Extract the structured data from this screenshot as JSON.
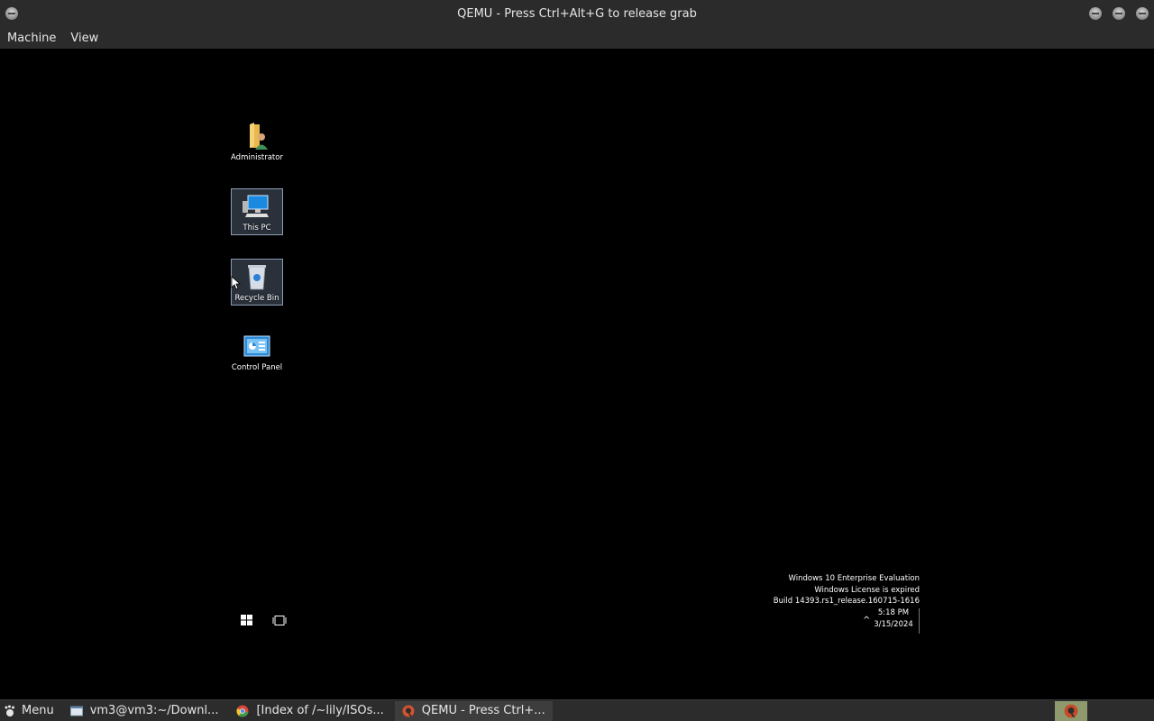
{
  "window": {
    "title": "QEMU - Press Ctrl+Alt+G to release grab",
    "menu": [
      "Machine",
      "View"
    ]
  },
  "desktop": {
    "icons": [
      {
        "label": "Administrator",
        "icon": "user-folder-icon",
        "selected": false
      },
      {
        "label": "This PC",
        "icon": "computer-icon",
        "selected": true
      },
      {
        "label": "Recycle Bin",
        "icon": "recycle-bin-icon",
        "selected": true
      },
      {
        "label": "Control Panel",
        "icon": "control-panel-icon",
        "selected": false
      }
    ],
    "watermark": [
      "Windows 10 Enterprise Evaluation",
      "Windows License is expired",
      "Build 14393.rs1_release.160715-1616"
    ],
    "tray": {
      "time": "5:18 PM",
      "date": "3/15/2024",
      "chevron": "^"
    }
  },
  "host_panel": {
    "menu_label": "Menu",
    "tasks": [
      {
        "label": "vm3@vm3:~/Downl...",
        "icon": "terminal-icon",
        "active": false
      },
      {
        "label": "[Index of /~lily/ISOs...",
        "icon": "chrome-icon",
        "active": false
      },
      {
        "label": "QEMU - Press Ctrl+...",
        "icon": "qemu-icon",
        "active": true
      }
    ]
  },
  "colors": {
    "host_bar": "#2b2b2b",
    "guest_background": "#000000",
    "selection": "#8a9bb3"
  }
}
